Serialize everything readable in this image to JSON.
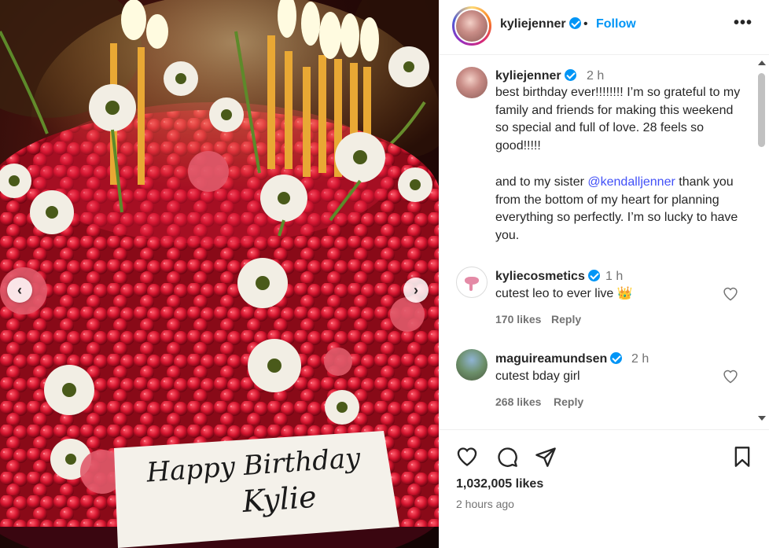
{
  "post": {
    "username": "kyliejenner",
    "follow_label": "Follow",
    "separator": "•",
    "more_label": "•••",
    "cake_text_line1": "Happy Birthday",
    "cake_text_line2": "Kylie"
  },
  "caption": {
    "username": "kyliejenner",
    "time": "2 h",
    "text_part1": "best birthday ever!!!!!!!! I’m so grateful to my family and friends for making this weekend so special and full of love. 28 feels so good!!!!!",
    "text_part2_before": "and to my sister ",
    "mention": "@kendalljenner",
    "text_part2_after": " thank you from the bottom of my heart for planning everything so perfectly. I’m so lucky to have you."
  },
  "comments": [
    {
      "username": "kyliecosmetics",
      "time": "1 h",
      "text": "cutest leo to ever live 👑",
      "likes": "170 likes",
      "reply": "Reply"
    },
    {
      "username": "maguireamundsen",
      "time": "2 h",
      "text": "cutest bday girl",
      "likes": "268 likes",
      "reply": "Reply"
    }
  ],
  "footer": {
    "likes": "1,032,005 likes",
    "time_ago": "2 hours ago"
  },
  "colors": {
    "accent": "#0095f6",
    "mention": "#4150f7",
    "secondary_text": "#737373"
  }
}
